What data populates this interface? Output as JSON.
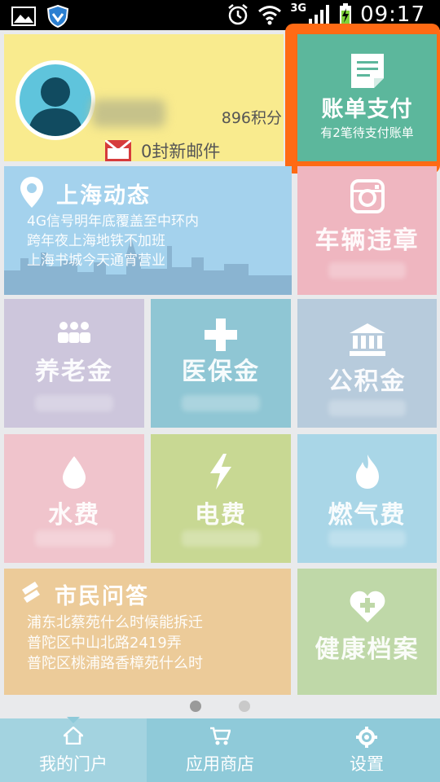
{
  "status_bar": {
    "time": "09:17",
    "network": "3G"
  },
  "profile": {
    "points": "896积分",
    "mail": "0封新邮件"
  },
  "bill": {
    "title": "账单支付",
    "subtitle": "有2笔待支付账单"
  },
  "news": {
    "title": "上海动态",
    "lines": [
      "4G信号明年底覆盖至中环内",
      "跨年夜上海地铁不加班",
      "上海书城今天通宵营业"
    ]
  },
  "tiles": {
    "vehicle": "车辆违章",
    "pension": "养老金",
    "medical": "医保金",
    "housing_fund": "公积金",
    "water": "水费",
    "electricity": "电费",
    "gas": "燃气费",
    "health": "健康档案"
  },
  "qa": {
    "title": "市民问答",
    "lines": [
      "浦东北蔡苑什么时候能拆迁",
      "普陀区中山北路2419弄",
      "普陀区桃浦路香樟苑什么时"
    ]
  },
  "bottom_nav": [
    {
      "label": "我的门户",
      "icon": "home-icon"
    },
    {
      "label": "应用商店",
      "icon": "cart-icon"
    },
    {
      "label": "设置",
      "icon": "gear-icon"
    }
  ],
  "page_indicator": {
    "pages": 2,
    "current": 1
  },
  "colors": {
    "profile": "#f9eb8e",
    "bill": "#5cb79c",
    "bill_highlight": "#ff6a14",
    "news": "#a4d2ed",
    "vehicle": "#efb6c0",
    "pension": "#cdc6dc",
    "medical": "#8fc6d4",
    "housing_fund": "#b7cbdc",
    "water": "#f0c4cc",
    "electricity": "#c8d893",
    "gas": "#a9d6e7",
    "qa": "#eccb99",
    "health": "#bfd8a8",
    "bottom_nav": "#8fcad9"
  }
}
